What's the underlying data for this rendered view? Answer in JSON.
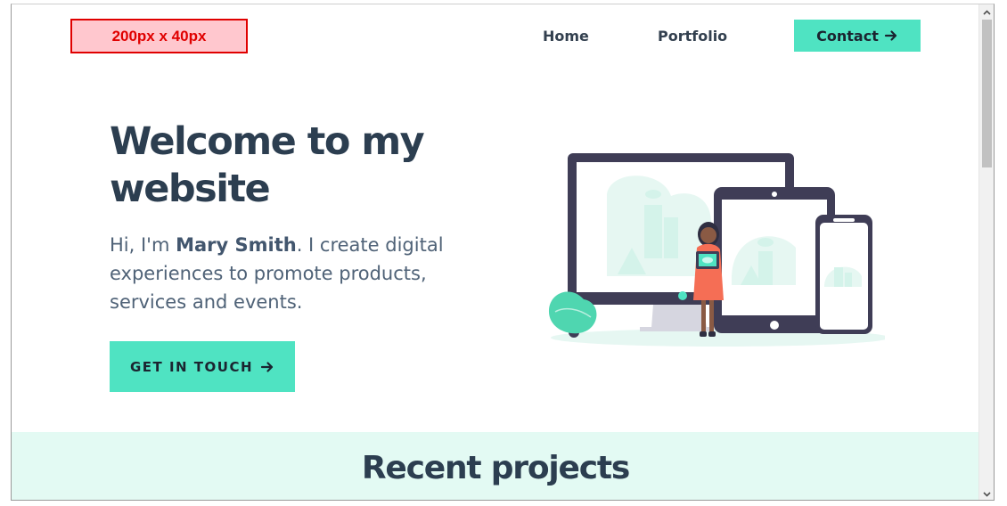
{
  "header": {
    "logo_placeholder": "200px x 40px",
    "nav": {
      "home": "Home",
      "portfolio": "Portfolio"
    },
    "contact": {
      "label": "Contact",
      "icon": "arrow-right-icon"
    }
  },
  "hero": {
    "title_line1": "Welcome to my",
    "title_line2": "website",
    "intro_prefix": "Hi, I'm ",
    "intro_name": "Mary Smith",
    "intro_suffix": ". I create digital experiences to promote products, services and events.",
    "cta": {
      "label": "GET IN TOUCH",
      "icon": "arrow-right-icon"
    }
  },
  "projects": {
    "title": "Recent projects"
  },
  "colors": {
    "accent": "#4fe3c2",
    "heading": "#2c3e50",
    "body_text": "#4f6277",
    "band": "#e3faf3",
    "placeholder_border": "#e00000",
    "placeholder_fill": "#ffc7ce"
  }
}
